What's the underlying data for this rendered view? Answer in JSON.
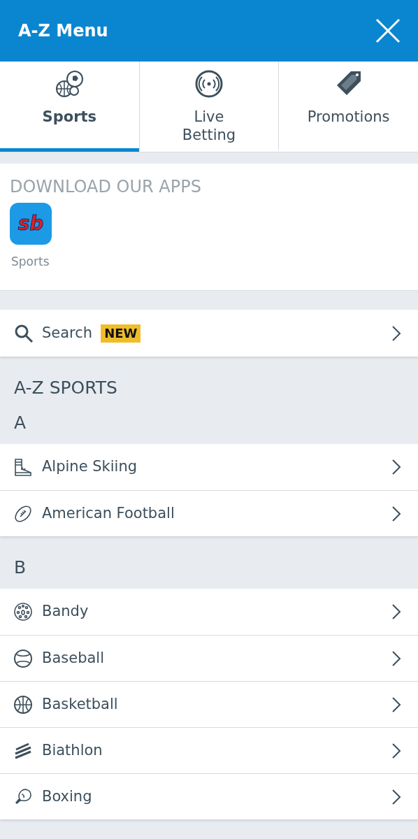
{
  "header": {
    "title": "A-Z Menu"
  },
  "tabs": [
    {
      "label": "Sports",
      "kind": "balls",
      "selected": true
    },
    {
      "label": "Live Betting",
      "kind": "live",
      "selected": false
    },
    {
      "label": "Promotions",
      "kind": "tag",
      "selected": false
    }
  ],
  "apps": {
    "heading": "DOWNLOAD OUR APPS",
    "items": [
      {
        "logo_text": "sb",
        "label": "Sports"
      }
    ]
  },
  "search": {
    "label": "Search",
    "badge": "NEW"
  },
  "az": {
    "heading": "A-Z SPORTS",
    "groups": [
      {
        "letter": "A",
        "items": [
          {
            "label": "Alpine Skiing",
            "kind": "boot"
          },
          {
            "label": "American Football",
            "kind": "football"
          }
        ]
      },
      {
        "letter": "B",
        "items": [
          {
            "label": "Bandy",
            "kind": "bandy"
          },
          {
            "label": "Baseball",
            "kind": "baseball"
          },
          {
            "label": "Basketball",
            "kind": "basketball"
          },
          {
            "label": "Biathlon",
            "kind": "biathlon"
          },
          {
            "label": "Boxing",
            "kind": "glove"
          }
        ]
      }
    ]
  }
}
